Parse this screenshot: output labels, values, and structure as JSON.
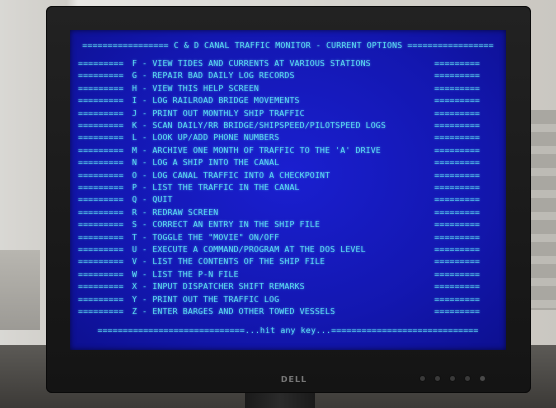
{
  "screen": {
    "title_line": "================= C & D CANAL TRAFFIC MONITOR - CURRENT OPTIONS =================",
    "left_bar": "=========",
    "right_bar": "=========",
    "options": [
      {
        "key": "F",
        "text": "F - VIEW TIDES AND CURRENTS AT VARIOUS STATIONS"
      },
      {
        "key": "G",
        "text": "G - REPAIR BAD DAILY LOG RECORDS"
      },
      {
        "key": "H",
        "text": "H - VIEW THIS HELP SCREEN"
      },
      {
        "key": "I",
        "text": "I - LOG RAILROAD BRIDGE MOVEMENTS"
      },
      {
        "key": "J",
        "text": "J - PRINT OUT MONTHLY SHIP TRAFFIC"
      },
      {
        "key": "K",
        "text": "K - SCAN DAILY/RR BRIDGE/SHIPSPEED/PILOTSPEED LOGS"
      },
      {
        "key": "L",
        "text": "L - LOOK UP/ADD PHONE NUMBERS"
      },
      {
        "key": "M",
        "text": "M - ARCHIVE ONE MONTH OF TRAFFIC TO THE 'A' DRIVE"
      },
      {
        "key": "N",
        "text": "N - LOG A SHIP INTO THE CANAL"
      },
      {
        "key": "O",
        "text": "O - LOG CANAL TRAFFIC INTO A CHECKPOINT"
      },
      {
        "key": "P",
        "text": "P - LIST THE TRAFFIC IN THE CANAL"
      },
      {
        "key": "Q",
        "text": "Q - QUIT"
      },
      {
        "key": "R",
        "text": "R - REDRAW SCREEN"
      },
      {
        "key": "S",
        "text": "S - CORRECT AN ENTRY IN THE SHIP FILE"
      },
      {
        "key": "T",
        "text": "T - TOGGLE THE \"MOVIE\" ON/OFF"
      },
      {
        "key": "U",
        "text": "U - EXECUTE A COMMAND/PROGRAM AT THE DOS LEVEL"
      },
      {
        "key": "V",
        "text": "V - LIST THE CONTENTS OF THE SHIP FILE"
      },
      {
        "key": "W",
        "text": "W - LIST THE P-N FILE"
      },
      {
        "key": "X",
        "text": "X - INPUT DISPATCHER SHIFT REMARKS"
      },
      {
        "key": "Y",
        "text": "Y - PRINT OUT THE TRAFFIC LOG"
      },
      {
        "key": "Z",
        "text": "Z - ENTER BARGES AND OTHER TOWED VESSELS"
      }
    ],
    "footer_line": "=============================...hit any key...============================="
  },
  "monitor": {
    "brand": "DELL"
  },
  "colors": {
    "screen_bg": "#1317b0",
    "text": "#5ce0f2"
  }
}
